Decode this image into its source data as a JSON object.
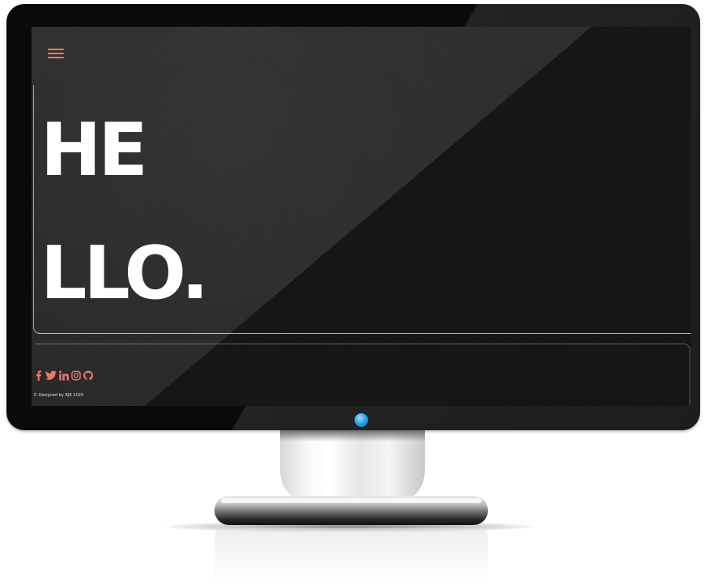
{
  "hero": {
    "line1": "HE",
    "line2": "LLO."
  },
  "nav": {
    "menu_icon": "hamburger-menu-icon"
  },
  "social": {
    "icons": [
      "facebook-icon",
      "twitter-icon",
      "linkedin-icon",
      "instagram-icon",
      "github-icon"
    ]
  },
  "footer": {
    "copyright": "© Designed by RJR 2020"
  },
  "colors": {
    "accent": "#e9786c",
    "text": "#ffffff",
    "background": "#151515",
    "power_led": "#2ca8e8"
  }
}
